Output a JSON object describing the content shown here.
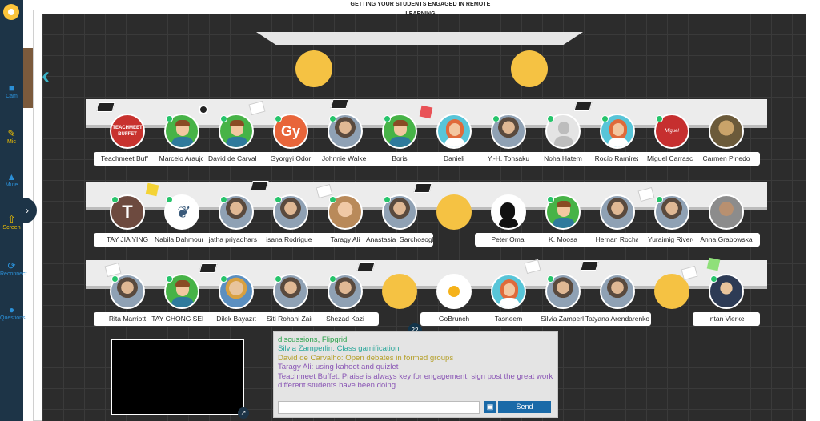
{
  "page": {
    "title": "GETTING YOUR STUDENTS ENGAGED IN REMOTE LEARNING"
  },
  "colors": {
    "sidebar": "#1d3447",
    "accent_blue": "#2b8fd6",
    "accent_yellow": "#f2c200",
    "stage": "#2c2c2c",
    "online": "#27c46b",
    "send": "#1a6aa8"
  },
  "toolbar": {
    "items": [
      {
        "label": "Cam",
        "icon": "camera-icon"
      },
      {
        "label": "Mic",
        "icon": "mic-icon"
      },
      {
        "label": "Mute",
        "icon": "speaker-icon"
      },
      {
        "label": "Screen",
        "icon": "screen-share-icon"
      },
      {
        "label": "Reconnect",
        "icon": "reconnect-icon"
      },
      {
        "label": "Questions",
        "icon": "question-icon"
      }
    ]
  },
  "rows": [
    {
      "seats": [
        "Teachmeet Buffet",
        "Marcelo Araujo",
        "David de Carvalho",
        "Gyorgyi Odor",
        "Johnnie Walker",
        "Boris",
        "Danieli",
        "Y.-H. Tohsaku",
        "Noha Hatem",
        "Rocío Ramírez",
        "Miguel Carrasco",
        "Carmen Pinedo"
      ]
    },
    {
      "seats": [
        "TAY JIA YING",
        "Nabila Dahmoune",
        "jatha priyadharsini",
        "isana Rodriguez",
        "Taragy Ali",
        "Anastasia_Sarchosoglou",
        "Peter Omal",
        "K. Moosa",
        "Hernan Rocha",
        "Yuraimig Rivero",
        "Anna Grabowska"
      ]
    },
    {
      "seats": [
        "Rita Marriott",
        "TAY CHONG SENG",
        "Dilek Bayazıt",
        "Siti Rohani Zain",
        "Shezad Kazi",
        "GoBrunch",
        "Tasneem",
        "Silvia Zamperli",
        "Tatyana Arendarenko",
        "Intan Vierke"
      ]
    }
  ],
  "avatar_text": {
    "teachmeet": "TEACHMEET BUFFET",
    "gy": "Gy",
    "t": "T",
    "miguel": "Miguel Carrasco"
  },
  "chat": {
    "counter": "22",
    "messages": [
      {
        "text": "discussions, Flipgrid",
        "color": "#2aa14a"
      },
      {
        "text": "Silvia Zamperlin: Class gamification",
        "color": "#29a79a"
      },
      {
        "text": "David de Carvalho: Open debates in formed groups",
        "color": "#b5a02a"
      },
      {
        "text": "Taragy Ali: using kahoot and quizlet",
        "color": "#8a56b5"
      },
      {
        "text": "Teachmeet Buffet: Praise is always key for engagement, sign post the great work different students have been doing",
        "color": "#8a56b5"
      }
    ],
    "send_label": "Send"
  }
}
